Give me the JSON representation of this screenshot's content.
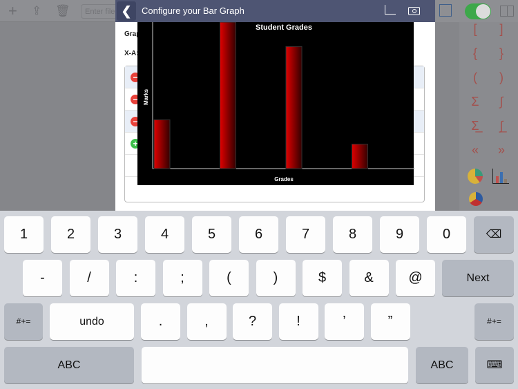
{
  "toolbar": {
    "file_placeholder": "Enter file",
    "icons": [
      "plus-icon",
      "share-icon",
      "trash-icon"
    ]
  },
  "modal": {
    "title": "Configure your Bar Graph",
    "back_icon": "chevron-left-icon",
    "graph_label": "Grap",
    "xaxis_label": "X-A:",
    "header_icons": [
      "edit-icon",
      "camera-icon"
    ]
  },
  "rows": [
    {
      "action": "remove"
    },
    {
      "action": "remove"
    },
    {
      "action": "remove"
    },
    {
      "action": "add"
    }
  ],
  "right": {
    "toggle_on": true,
    "symbols": [
      "[",
      "]",
      "{",
      "}",
      "(",
      ")",
      "Σ",
      "∫",
      "Σ̲",
      "∫̲",
      "«",
      "»"
    ]
  },
  "chart_data": {
    "type": "bar",
    "title": "Student Grades",
    "xlabel": "Grades",
    "ylabel": "Marks",
    "categories": [
      "",
      "",
      "",
      ""
    ],
    "values": [
      20,
      62,
      50,
      10
    ],
    "ylim": [
      0,
      60
    ],
    "grid": false,
    "bar_color": "#e00000",
    "background": "#000000"
  },
  "keyboard": {
    "row1": [
      "1",
      "2",
      "3",
      "4",
      "5",
      "6",
      "7",
      "8",
      "9",
      "0"
    ],
    "row2": [
      "-",
      "/",
      ":",
      ";",
      "(",
      ")",
      "$",
      "&",
      "@"
    ],
    "next": "Next",
    "row3_left": "#+=",
    "undo": "undo",
    "row3": [
      ".",
      ",",
      "?",
      "!",
      "’",
      "”"
    ],
    "row3_right": "#+=",
    "abc_left": "ABC",
    "abc_right": "ABC"
  }
}
